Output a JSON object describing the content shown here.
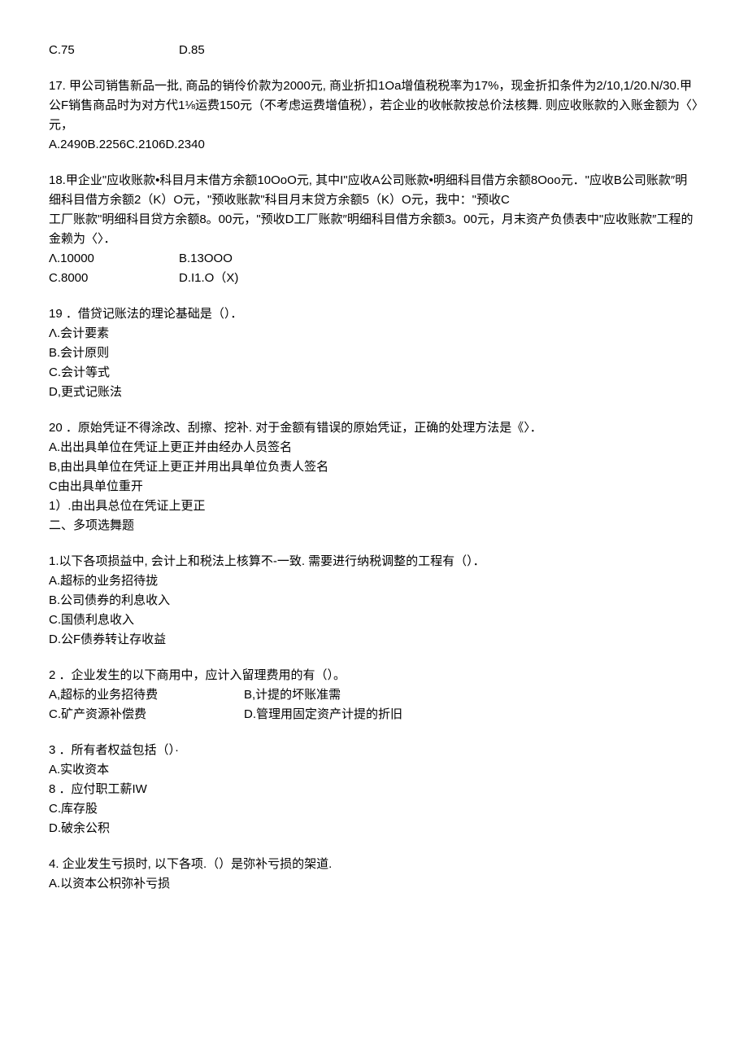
{
  "q16_opts": {
    "c": "C.75",
    "d": "D.85"
  },
  "q17": {
    "l1": "17. 甲公司销售新品一批, 商品的销伶价款为2000元, 商业折扣1Oa增值税税率为17%，现金折扣条件为2/10,1/20.N/30.甲公F销售商品时为对方代1⅛运费150元（不考虑运费增值税），若企业的收帐款按总价法核舞. 则应收账款的入账金额为〈〉元，",
    "opts": "A.2490B.2256C.2106D.2340"
  },
  "q18": {
    "l1": "18.甲企业\"应收账款•科目月末借方余额10OoO元, 其中I\"应收A公司账款•明细科目借方余额8Ooo元．\"应收B公司账款″明细科目借方余额2（K）O元，\"预收账款\"科目月末贷方余额5（K）O元，我中：\"预收C",
    "l2": "工厂账款\"明细科目贷方余额8。00元，\"预收D工厂账款″明细科目借方余额3。00元，月末资产负债表中\"应收账款″工程的金赖为〈〉．",
    "opts_ab_a": "Λ.10000",
    "opts_ab_b": "B.13OOO",
    "opts_cd_c": "C.8000",
    "opts_cd_d": "D.I1.O（X)"
  },
  "q19": {
    "stem": "19 ．借贷记账法的理论基础是（）．",
    "a": "Λ.会计要素",
    "b": "B.会计原则",
    "c": "C.会计等式",
    "d": "D,更式记账法"
  },
  "q20": {
    "stem": "20 ．原始凭证不得涂改、刮擦、挖补. 对于金额有错误的原始凭证，正确的处理方法是《〉．",
    "a": "A.出出具单位在凭证上更正并由经办人员签名",
    "b": "B,由出具单位在凭证上更正并用出具单位负责人签名",
    "c": "C由出具单位重开",
    "d": "1）.由出具总位在凭证上更正"
  },
  "section2": "二、多项选舞题",
  "m1": {
    "stem": "1.以下各项损益中, 会计上和税法上核算不-一致. 需要进行纳税调整的工程有（）．",
    "a": "A.超标的业务招待拢",
    "b": "B.公司债券的利息收入",
    "c": "C.国债利息收入",
    "d": "D.公F债券转让存收益"
  },
  "m2": {
    "stem": "2 ．企业发生的以下商用中，应计入留理费用的有（）。",
    "a": "A,超标的业务招待费",
    "b": "B,计提的坏账准需",
    "c": "C.矿产资源补偿费",
    "d": "D.管理用固定资产计提的折旧"
  },
  "m3": {
    "stem": "3 ．所有者权益包括（）·",
    "a": "A.实收资本",
    "b": "8 ．应付职工薪IW",
    "c": "C.库存股",
    "d": "D.破余公积"
  },
  "m4": {
    "stem": "4. 企业发生亏损时, 以下各项.（）是弥补亏损的架道.",
    "a": "A.以资本公枳弥补亏损"
  }
}
